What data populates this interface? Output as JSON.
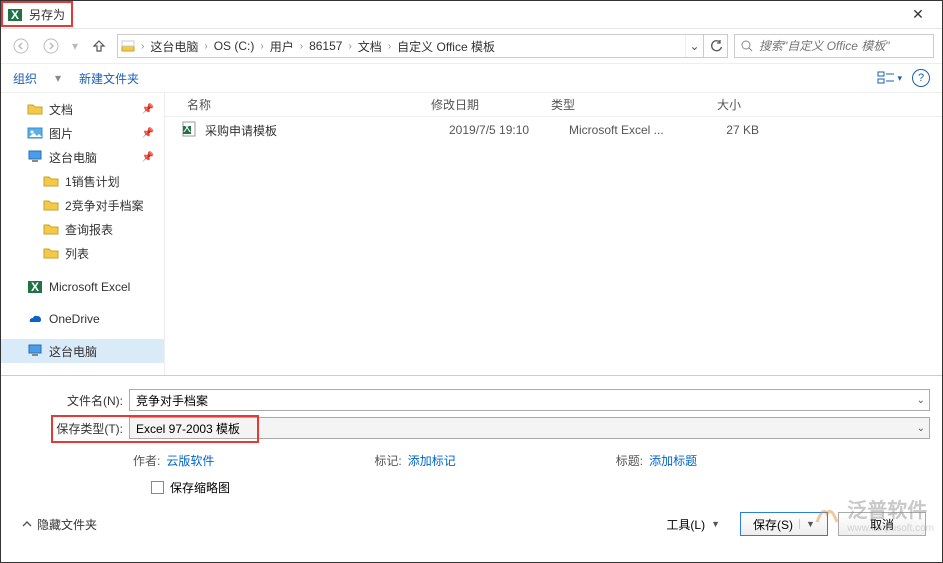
{
  "window": {
    "title": "另存为"
  },
  "nav": {
    "breadcrumb": [
      "这台电脑",
      "OS (C:)",
      "用户",
      "86157",
      "文档",
      "自定义 Office 模板"
    ],
    "search_placeholder": "搜索\"自定义 Office 模板\""
  },
  "toolbar": {
    "organize": "组织",
    "newfolder": "新建文件夹"
  },
  "sidebar": {
    "items": [
      {
        "label": "文档",
        "icon": "folder",
        "pinned": true
      },
      {
        "label": "图片",
        "icon": "pictures",
        "pinned": true
      },
      {
        "label": "这台电脑",
        "icon": "pc",
        "pinned": true
      },
      {
        "label": "1销售计划",
        "icon": "folder",
        "indent": true
      },
      {
        "label": "2竞争对手档案",
        "icon": "folder",
        "indent": true
      },
      {
        "label": "查询报表",
        "icon": "folder",
        "indent": true
      },
      {
        "label": "列表",
        "icon": "folder",
        "indent": true
      },
      {
        "label": "Microsoft Excel",
        "icon": "excel"
      },
      {
        "label": "OneDrive",
        "icon": "onedrive"
      },
      {
        "label": "这台电脑",
        "icon": "pc",
        "selected": true
      }
    ]
  },
  "columns": {
    "name": "名称",
    "date": "修改日期",
    "type": "类型",
    "size": "大小"
  },
  "files": [
    {
      "name": "采购申请模板",
      "date": "2019/7/5 19:10",
      "type": "Microsoft Excel ...",
      "size": "27 KB"
    }
  ],
  "form": {
    "filename_label": "文件名(N):",
    "filename_value": "竞争对手档案",
    "filetype_label": "保存类型(T):",
    "filetype_value": "Excel 97-2003 模板",
    "author_label": "作者:",
    "author_value": "云版软件",
    "tags_label": "标记:",
    "tags_value": "添加标记",
    "title_label": "标题:",
    "title_value": "添加标题",
    "thumb_label": "保存缩略图"
  },
  "footer": {
    "hide": "隐藏文件夹",
    "tools": "工具(L)",
    "save": "保存(S)",
    "cancel": "取消"
  },
  "watermark": {
    "text": "泛普软件",
    "sub": "www.fanpusoft.com"
  }
}
